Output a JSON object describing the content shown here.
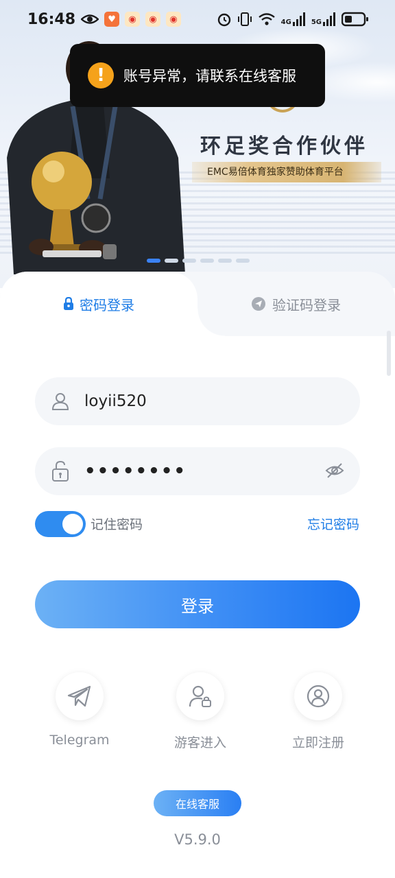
{
  "status_bar": {
    "time": "16:48",
    "network_4g": "4G",
    "network_5g": "5G",
    "left_icons": [
      "eye-icon",
      "app-badge-icon",
      "weibo-icon",
      "weibo-icon",
      "weibo-icon"
    ],
    "right_icons": [
      "alarm-icon",
      "vibrate-icon",
      "wifi-icon",
      "signal-icon",
      "signal-icon",
      "battery-icon"
    ]
  },
  "toast": {
    "icon": "!",
    "message": "账号异常，请联系在线客服"
  },
  "banner": {
    "title": "环足奖合作伙伴",
    "subtitle": "EMC易倍体育独家赞助体育平台",
    "slides": 6,
    "active_slide": 1
  },
  "tabs": {
    "password_login": "密码登录",
    "code_login": "验证码登录"
  },
  "form": {
    "username_value": "loyii520",
    "password_value": "••••••••",
    "remember_label": "记住密码",
    "remember_checked": true,
    "forgot_label": "忘记密码",
    "login_label": "登录"
  },
  "quick_options": [
    {
      "label": "Telegram",
      "icon": "telegram-icon"
    },
    {
      "label": "游客进入",
      "icon": "guest-user-icon"
    },
    {
      "label": "立即注册",
      "icon": "register-user-icon"
    }
  ],
  "footer": {
    "support_label": "在线客服",
    "version": "V5.9.0"
  },
  "colors": {
    "accent": "#1f7de6",
    "toast_bg": "#0f0f0f",
    "warning": "#f5a21b"
  }
}
